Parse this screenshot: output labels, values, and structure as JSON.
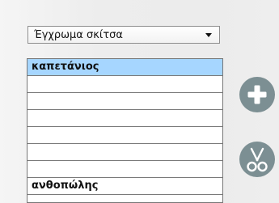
{
  "dropdown": {
    "selected": "Έγχρωμα σκίτσα"
  },
  "list": {
    "items": [
      {
        "label": "καπετάνιος",
        "selected": true
      },
      {
        "label": ""
      },
      {
        "label": ""
      },
      {
        "label": ""
      },
      {
        "label": ""
      },
      {
        "label": ""
      },
      {
        "label": ""
      },
      {
        "label": "ανθοπώλης"
      }
    ]
  },
  "icons": {
    "add": "plus-icon",
    "cut": "scissors-icon"
  },
  "colors": {
    "selection": "#a6d6ff",
    "button": "#7c8f93"
  }
}
